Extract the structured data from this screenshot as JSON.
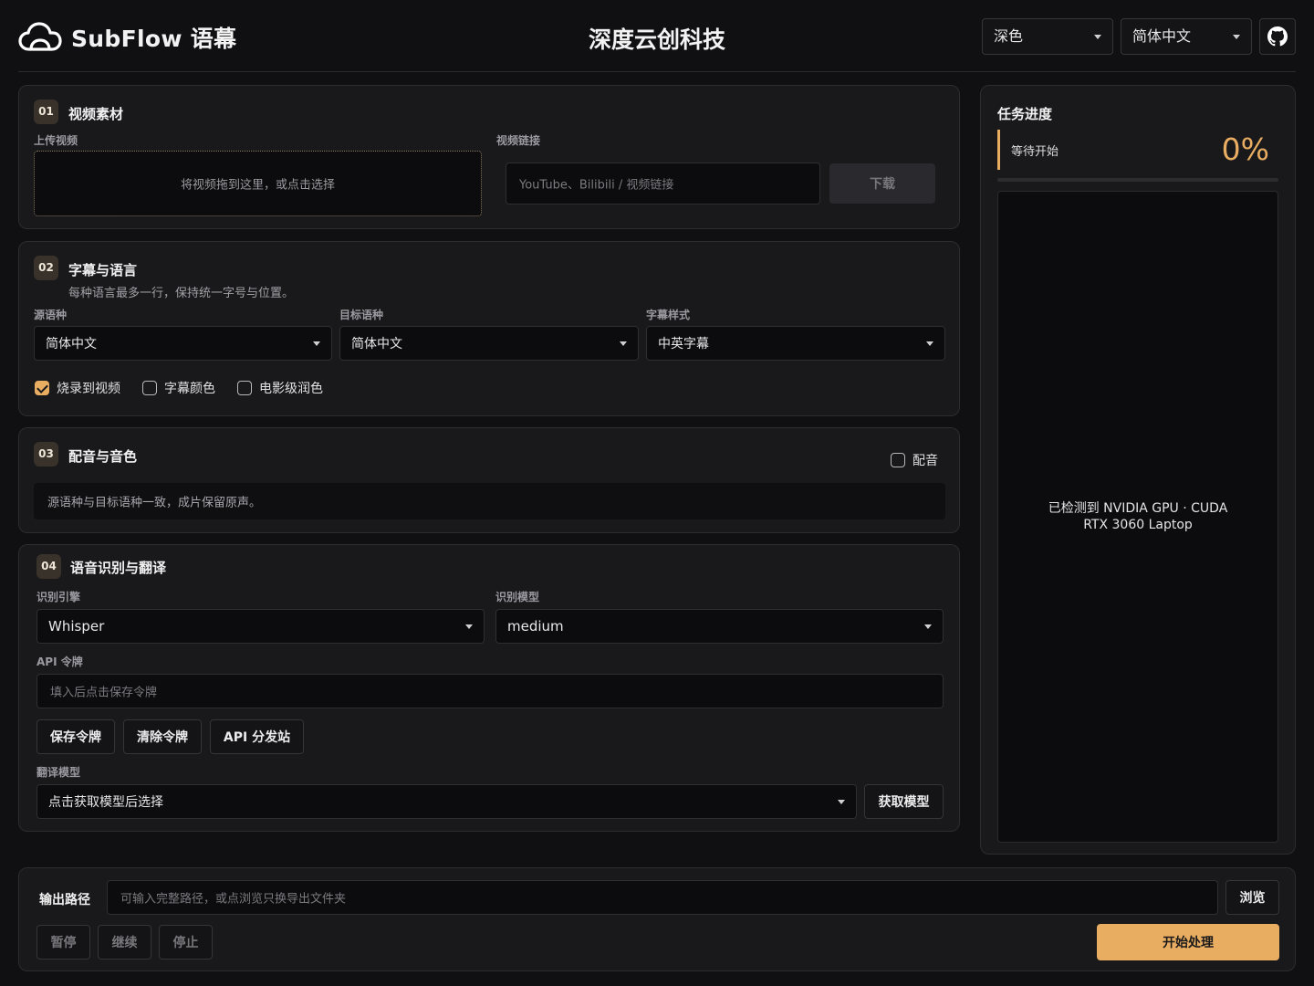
{
  "app": {
    "name": "SubFlow 语幕",
    "company": "深度云创科技",
    "theme_select": "深色",
    "lang_select": "简体中文"
  },
  "section1": {
    "num": "01",
    "title": "视频素材",
    "upload_label": "上传视频",
    "dropzone_text": "将视频拖到这里，或点击选择",
    "link_label": "视频链接",
    "link_placeholder": "YouTube、Bilibili / 视频链接",
    "download_button": "下载"
  },
  "section2": {
    "num": "02",
    "title": "字幕与语言",
    "subtitle": "每种语言最多一行，保持统一字号与位置。",
    "source_label": "源语种",
    "source_value": "简体中文",
    "target_label": "目标语种",
    "target_value": "简体中文",
    "style_label": "字幕样式",
    "style_value": "中英字幕",
    "checkboxes": [
      {
        "label": "烧录到视频",
        "checked": true
      },
      {
        "label": "字幕颜色",
        "checked": false
      },
      {
        "label": "电影级润色",
        "checked": false
      }
    ]
  },
  "section3": {
    "num": "03",
    "title": "配音与音色",
    "dub_toggle_label": "配音",
    "dub_checked": false,
    "info_text": "源语种与目标语种一致，成片保留原声。"
  },
  "section4": {
    "num": "04",
    "title": "语音识别与翻译",
    "engine_label": "识别引擎",
    "engine_value": "Whisper",
    "model_label": "识别模型",
    "model_value": "medium",
    "api_label": "API 令牌",
    "api_placeholder": "填入后点击保存令牌",
    "save_token": "保存令牌",
    "clear_token": "清除令牌",
    "api_station": "API 分发站",
    "translate_label": "翻译模型",
    "translate_value": "点击获取模型后选择",
    "fetch_models": "获取模型"
  },
  "progress": {
    "title": "任务进度",
    "status": "等待开始",
    "percent": "0%",
    "progress_fraction": 0,
    "gpu_line1": "已检测到 NVIDIA GPU · CUDA",
    "gpu_line2": "RTX 3060 Laptop"
  },
  "footer": {
    "output_label": "输出路径",
    "output_placeholder": "可输入完整路径，或点浏览只换导出文件夹",
    "browse": "浏览",
    "pause": "暂停",
    "resume": "继续",
    "stop": "停止",
    "start": "开始处理"
  },
  "colors": {
    "accent": "#e9ad62",
    "background": "#101013",
    "card": "#19191c"
  }
}
